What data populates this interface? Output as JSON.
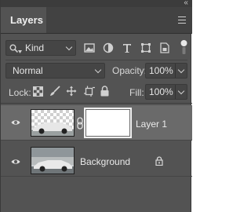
{
  "panel": {
    "tab_label": "Layers",
    "collapse_glyph": "‹‹"
  },
  "filter": {
    "kind_label": "Kind",
    "buttons": [
      "pixel-filter",
      "adjustment-filter",
      "type-filter",
      "shape-filter",
      "smart-object-filter"
    ]
  },
  "blend": {
    "mode": "Normal",
    "opacity_label": "Opacity:",
    "opacity_value": "100%"
  },
  "lock": {
    "label": "Lock:",
    "fill_label": "Fill:",
    "fill_value": "100%"
  },
  "layers": [
    {
      "name": "Layer 1",
      "selected": true,
      "has_mask": true,
      "locked": false
    },
    {
      "name": "Background",
      "selected": false,
      "has_mask": false,
      "locked": true
    }
  ],
  "colors": {
    "panel_bg": "#535353",
    "selected_layer_bg": "#6a6a6a",
    "tab_bar": "#424242"
  }
}
